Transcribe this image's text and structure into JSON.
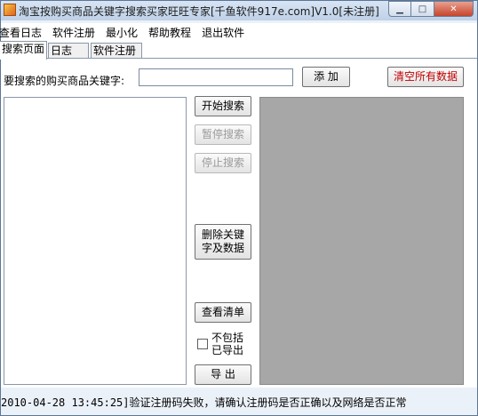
{
  "window": {
    "title": "淘宝按购买商品关键字搜索买家旺旺专家[千鱼软件917e.com]V1.0[未注册]",
    "controls": {
      "minimize": "▁",
      "maximize": "□",
      "close": "✕"
    }
  },
  "menu": {
    "items": [
      "查看日志",
      "软件注册",
      "最小化",
      "帮助教程",
      "退出软件"
    ]
  },
  "tabs": [
    "搜索页面",
    "日志",
    "软件注册"
  ],
  "search": {
    "keyword_label": "要搜索的购买商品关键字:",
    "keyword_value": "",
    "add_button": "添 加",
    "clear_all_button": "清空所有数据"
  },
  "actions": {
    "start_search": "开始搜索",
    "pause_search": "暂停搜索",
    "stop_search": "停止搜索",
    "delete_keyword_line1": "删除关键",
    "delete_keyword_line2": "字及数据",
    "view_list": "查看清单",
    "exclude_exported_line1": "不包括",
    "exclude_exported_line2": "已导出",
    "exclude_exported_checked": false,
    "export": "导 出"
  },
  "status": {
    "message": "2010-04-28 13:45:25]验证注册码失败，请确认注册码是否正确以及网络是否正常"
  }
}
